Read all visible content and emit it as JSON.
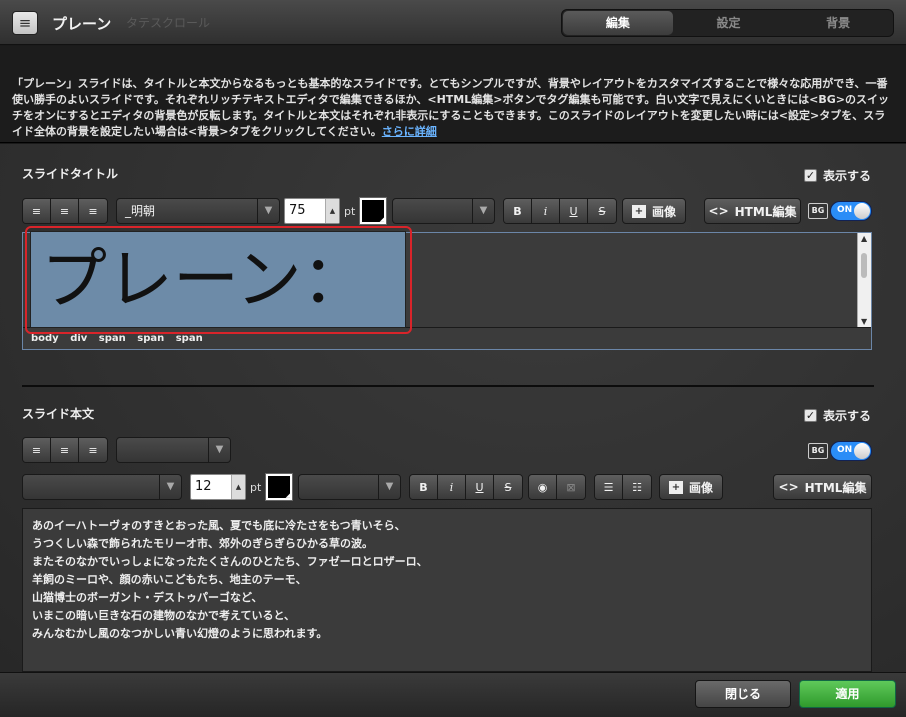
{
  "header": {
    "title": "プレーン",
    "ghost_text": "タテスクロール",
    "tabs": [
      {
        "label": "編集",
        "active": true
      },
      {
        "label": "設定",
        "active": false
      },
      {
        "label": "背景",
        "active": false
      }
    ]
  },
  "info": {
    "text": "「プレーン」スライドは、タイトルと本文からなるもっとも基本的なスライドです。とてもシンプルですが、背景やレイアウトをカスタマイズすることで様々な応用ができ、一番使い勝手のよいスライドです。それぞれリッチテキストエディタで編集できるほか、<HTML編集>ボタンでタグ編集も可能です。白い文字で見えにくいときには<BG>のスイッチをオンにするとエディタの背景色が反転します。タイトルと本文はそれぞれ非表示にすることもできます。このスライドのレイアウトを変更したい時には<設定>タブを、スライド全体の背景を設定したい場合は<背景>タブをクリックしてください。",
    "link": "さらに詳細"
  },
  "title_section": {
    "label": "スライドタイトル",
    "show_label": "表示する",
    "show_checked": true,
    "font": "_明朝",
    "font_size": "75",
    "unit": "pt",
    "color": "#000000",
    "image_label": "画像",
    "html_label": "HTML編集",
    "bg_badge": "BG",
    "toggle_label": "ON",
    "content": "プレーン：",
    "path": [
      "body",
      "div",
      "span",
      "span",
      "span"
    ]
  },
  "body_section": {
    "label": "スライド本文",
    "show_label": "表示する",
    "show_checked": true,
    "font": "",
    "font_size": "12",
    "unit": "pt",
    "color": "#000000",
    "image_label": "画像",
    "html_label": "HTML編集",
    "bg_badge": "BG",
    "toggle_label": "ON",
    "lines": [
      "あのイーハトーヴォのすきとおった風、夏でも底に冷たさをもつ青いそら、",
      "うつくしい森で飾られたモリーオ市、郊外のぎらぎらひかる草の波。",
      "またそのなかでいっしょになったたくさんのひとたち、ファゼーロとロザーロ、",
      "羊飼のミーロや、顔の赤いこどもたち、地主のテーモ、",
      "山猫博士のボーガント・デストゥパーゴなど、",
      "いまこの暗い巨きな石の建物のなかで考えていると、",
      "みんなむかし風のなつかしい青い幻燈のように思われます。"
    ]
  },
  "footer": {
    "close_label": "閉じる",
    "apply_label": "適用"
  },
  "colors": {
    "accent_blue": "#2a8df7",
    "apply_green": "#3fb13b",
    "highlight_red": "#d9242a"
  }
}
